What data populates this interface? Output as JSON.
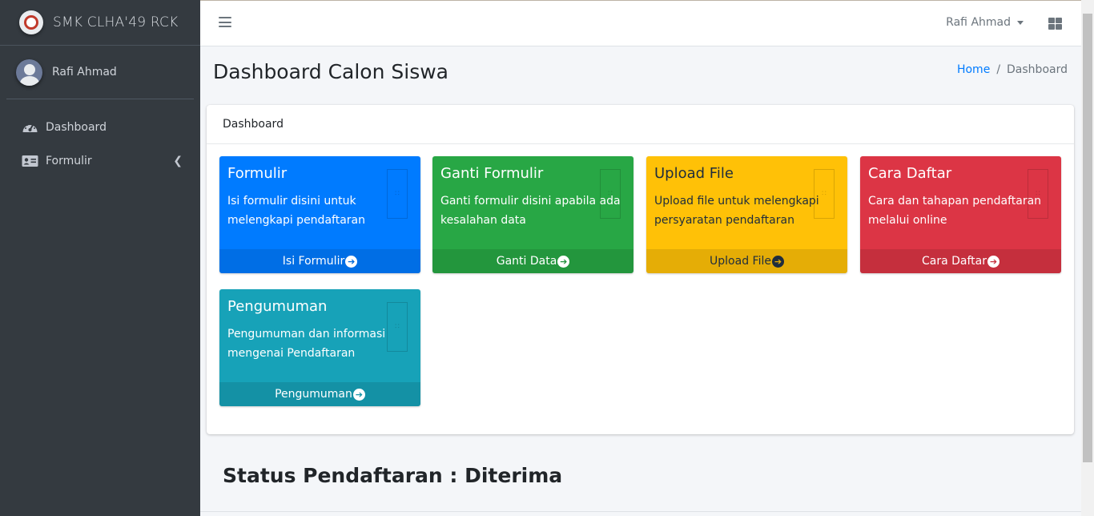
{
  "brand": {
    "name": "SMK CLHA'49 RCK",
    "logo_icon": "school-logo-icon"
  },
  "sidebar": {
    "user": {
      "name": "Rafi Ahmad",
      "avatar_icon": "user-avatar-icon"
    },
    "items": [
      {
        "label": "Dashboard",
        "icon": "tachometer-icon"
      },
      {
        "label": "Formulir",
        "icon": "id-card-icon"
      }
    ]
  },
  "topbar": {
    "user_name": "Rafi Ahmad"
  },
  "page": {
    "title": "Dashboard Calon Siswa",
    "breadcrumb": {
      "home": "Home",
      "current": "Dashboard"
    }
  },
  "card": {
    "header": "Dashboard",
    "boxes": [
      {
        "title": "Formulir",
        "desc": "Isi formulir disini untuk melengkapi pendaftaran",
        "link": "Isi Formulir",
        "color": "#007bff"
      },
      {
        "title": "Ganti Formulir",
        "desc": "Ganti formulir disini apabila ada kesalahan data",
        "link": "Ganti Data",
        "color": "#28a745"
      },
      {
        "title": "Upload File",
        "desc": "Upload file untuk melengkapi persyaratan pendaftaran",
        "link": "Upload File",
        "color": "#ffc107"
      },
      {
        "title": "Cara Daftar",
        "desc": "Cara dan tahapan pendaftaran melalui online",
        "link": "Cara Daftar",
        "color": "#dc3545"
      },
      {
        "title": "Pengumuman",
        "desc": "Pengumuman dan informasi mengenai Pendaftaran",
        "link": "Pengumuman",
        "color": "#17a2b8"
      }
    ]
  },
  "status": "Status Pendaftaran : Diterima"
}
